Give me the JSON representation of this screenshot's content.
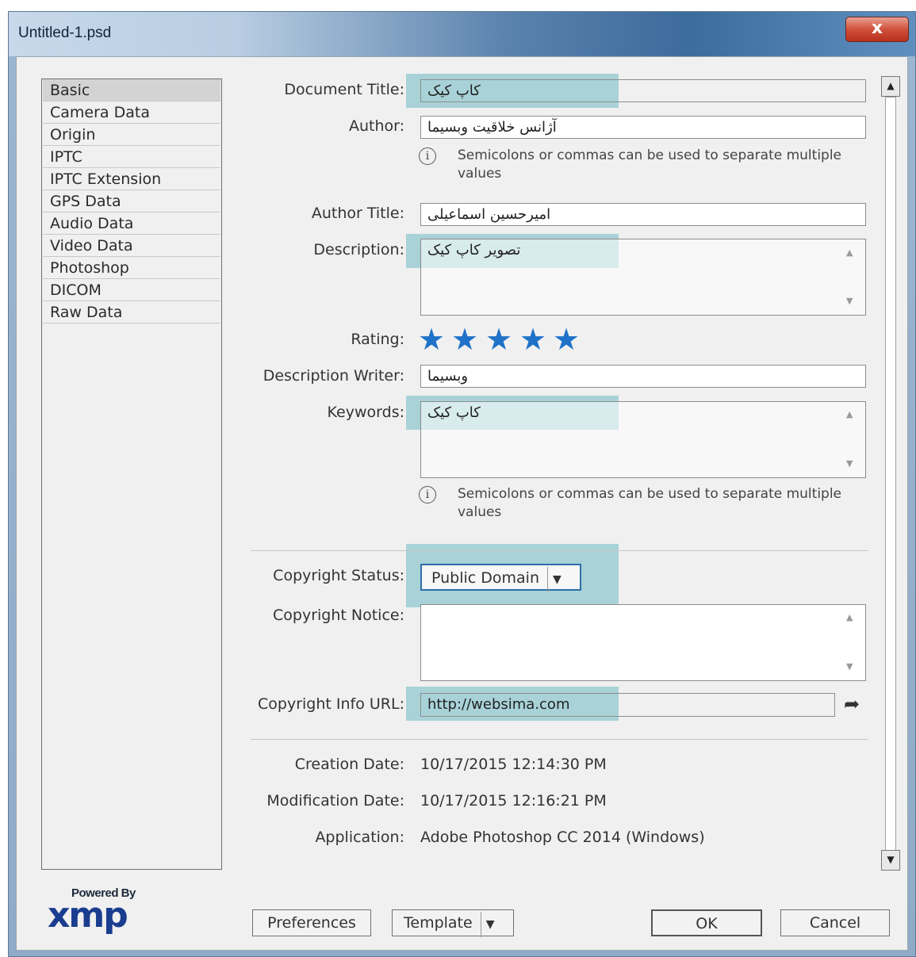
{
  "window": {
    "title": "Untitled-1.psd",
    "close_glyph": "x"
  },
  "nav": {
    "items": [
      "Basic",
      "Camera Data",
      "Origin",
      "IPTC",
      "IPTC Extension",
      "GPS Data",
      "Audio Data",
      "Video Data",
      "Photoshop",
      "DICOM",
      "Raw Data"
    ],
    "selected": "Basic"
  },
  "form": {
    "document_title": {
      "label": "Document Title:",
      "value": "کاپ کیک"
    },
    "author": {
      "label": "Author:",
      "value": "آژانس خلاقیت وبسیما"
    },
    "author_hint": "Semicolons or commas can be used to separate multiple values",
    "author_title": {
      "label": "Author Title:",
      "value": "امیرحسین اسماعیلی"
    },
    "description": {
      "label": "Description:",
      "value": "تصویر کاپ کیک"
    },
    "rating": {
      "label": "Rating:",
      "stars": 5,
      "max": 5
    },
    "description_writer": {
      "label": "Description Writer:",
      "value": "وبسیما"
    },
    "keywords": {
      "label": "Keywords:",
      "value": "کاپ کیک"
    },
    "keywords_hint": "Semicolons or commas can be used to separate multiple values",
    "copyright_status": {
      "label": "Copyright Status:",
      "value": "Public Domain"
    },
    "copyright_notice": {
      "label": "Copyright Notice:",
      "value": ""
    },
    "copyright_url": {
      "label": "Copyright Info URL:",
      "value": "http://websima.com"
    },
    "creation_date": {
      "label": "Creation Date:",
      "value": "10/17/2015 12:14:30 PM"
    },
    "modification_date": {
      "label": "Modification Date:",
      "value": "10/17/2015 12:16:21 PM"
    },
    "application": {
      "label": "Application:",
      "value": "Adobe Photoshop CC 2014 (Windows)"
    }
  },
  "footer": {
    "powered_by": "Powered By",
    "logo": "xmp",
    "preferences": "Preferences",
    "template": "Template",
    "ok": "OK",
    "cancel": "Cancel"
  },
  "icons": {
    "info": "info-icon",
    "star": "star-icon",
    "goto": "arrow-icon",
    "dropdown": "dropdown-arrow-icon"
  },
  "colors": {
    "star": "#1f72c8",
    "highlight": "#6eb9c3",
    "title_gradient_end": "#3d6b9c"
  }
}
